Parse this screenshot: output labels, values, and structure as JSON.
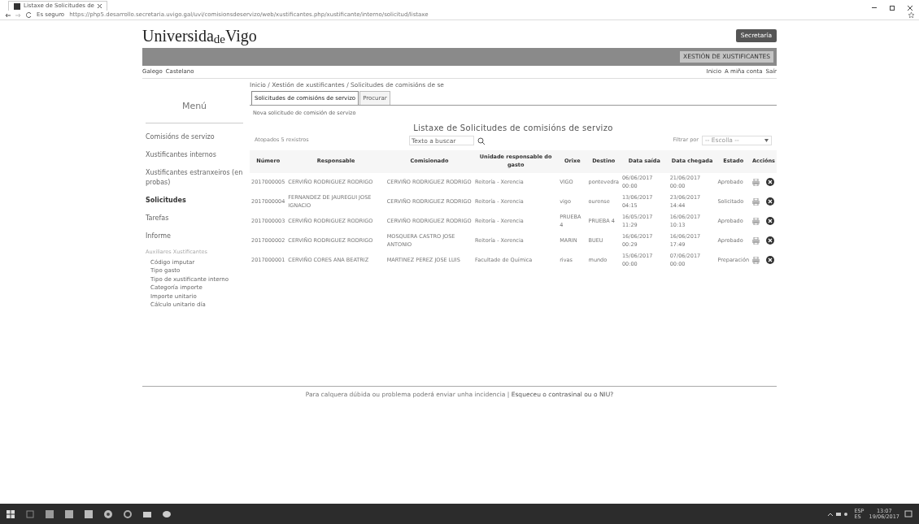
{
  "browser": {
    "tab_title": "Listaxe de Solicitudes de",
    "security": "Es seguro",
    "url": "https://php5.desarrollo.secretaria.uvigo.gal/uvi/comisionsdeservizo/web/xustificantes.php/xustificante/interno/solicitud/listaxe"
  },
  "header": {
    "logo": [
      "Universida",
      "de",
      "Vigo"
    ],
    "button": "Secretaría",
    "banner_label": "XESTIÓN DE XUSTIFICANTES"
  },
  "languages": [
    "Galego",
    "Castelano"
  ],
  "user_links": [
    "Inicio",
    "A miña conta",
    "Saír"
  ],
  "breadcrumb": "Inicio / Xestión de xustificantes / Solicitudes de comisións de se",
  "tabs": [
    {
      "label": "Solicitudes de comisións de servizo",
      "selected": true
    },
    {
      "label": "Procurar",
      "selected": false
    }
  ],
  "sidebar": {
    "title": "Menú",
    "items": [
      {
        "label": "Comisións de servizo",
        "kind": "link",
        "selected": false
      },
      {
        "label": "Xustificantes internos",
        "kind": "link",
        "selected": false
      },
      {
        "label": "Xustificantes estranxeiros (en probas)",
        "kind": "link",
        "selected": false
      },
      {
        "label": "Solicitudes",
        "kind": "link",
        "selected": true
      },
      {
        "label": "Tarefas",
        "kind": "link",
        "selected": false
      },
      {
        "label": "Informe",
        "kind": "link",
        "selected": false
      },
      {
        "label": "Auxiliares Xustificantes",
        "kind": "heading",
        "selected": false
      },
      {
        "label": "Código imputar",
        "kind": "sub",
        "selected": false
      },
      {
        "label": "Tipo gasto",
        "kind": "sub",
        "selected": false
      },
      {
        "label": "Tipo de xustificante interno",
        "kind": "sub",
        "selected": false
      },
      {
        "label": "Categoría importe",
        "kind": "sub",
        "selected": false
      },
      {
        "label": "Importe unitario",
        "kind": "sub",
        "selected": false
      },
      {
        "label": "Cálculo unitario día",
        "kind": "sub",
        "selected": false
      }
    ]
  },
  "new_link": "Nova solicitude de comisión de servizo",
  "list_title": "Listaxe de Solicitudes de comisións de servizo",
  "found": "Atopados 5 rexistros",
  "search": {
    "placeholder": "Texto a buscar"
  },
  "filter": {
    "label": "Filtrar por",
    "value": "-- Escolla --"
  },
  "table": {
    "columns": [
      "Número",
      "Responsable",
      "Comisionado",
      "Unidade responsable do gasto",
      "Orixe",
      "Destino",
      "Data saída",
      "Data chegada",
      "Estado",
      "Accións"
    ],
    "rows": [
      [
        "2017000005",
        "CERVIÑO RODRIGUEZ RODRIGO",
        "CERVIÑO RODRIGUEZ RODRIGO",
        "Reitoría - Xerencia",
        "VIGO",
        "pontevedra",
        "06/06/2017 00:00",
        "21/06/2017 00:00",
        "Aprobado"
      ],
      [
        "2017000004",
        "FERNANDEZ DE JAUREGUI JOSE IGNACIO",
        "CERVIÑO RODRIGUEZ RODRIGO",
        "Reitoría - Xerencia",
        "vigo",
        "ourense",
        "13/06/2017 04:15",
        "23/06/2017 14:44",
        "Solicitado"
      ],
      [
        "2017000003",
        "CERVIÑO RODRIGUEZ RODRIGO",
        "CERVIÑO RODRIGUEZ RODRIGO",
        "Reitoría - Xerencia",
        "PRUEBA 4",
        "PRUEBA 4",
        "16/05/2017 11:29",
        "16/06/2017 10:13",
        "Aprobado"
      ],
      [
        "2017000002",
        "CERVIÑO RODRIGUEZ RODRIGO",
        "MOSQUERA CASTRO JOSE ANTONIO",
        "Reitoría - Xerencia",
        "MARIN",
        "BUEU",
        "16/06/2017 00:29",
        "16/06/2017 17:49",
        "Aprobado"
      ],
      [
        "2017000001",
        "CERVIÑO CORES ANA BEATRIZ",
        "MARTINEZ PEREZ JOSE LUIS",
        "Facultade de Química",
        "rivas",
        "mundo",
        "15/06/2017 00:00",
        "07/06/2017 00:00",
        "Preparación"
      ]
    ]
  },
  "footer": {
    "text": "Para calquera dúbida ou problema poderá enviar unha incidencia",
    "separator": "|",
    "link": "Esqueceu o contrasinal ou o NIU?"
  },
  "taskbar": {
    "language": "ESP",
    "region": "ES",
    "time": "13:07",
    "date": "19/06/2017"
  }
}
